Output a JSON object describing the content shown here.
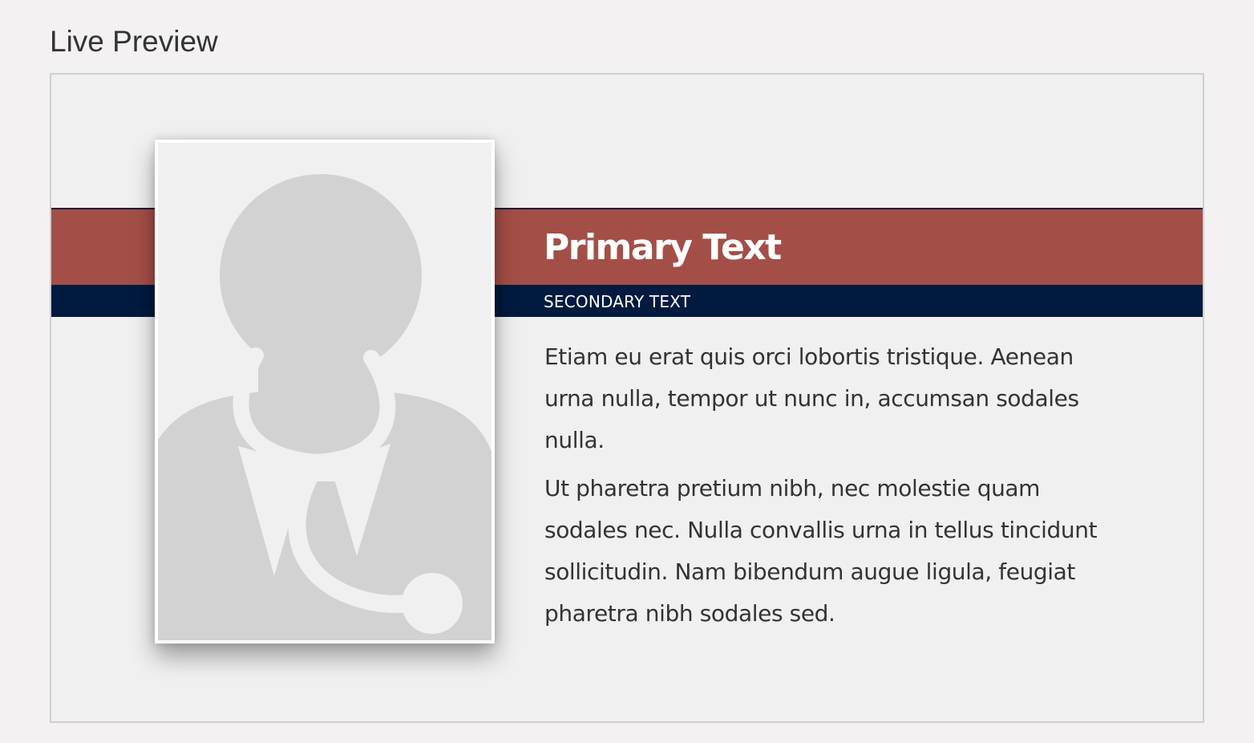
{
  "section": {
    "title": "Live Preview"
  },
  "preview": {
    "primary_text": "Primary Text",
    "secondary_text": "SECONDARY TEXT",
    "paragraphs": [
      "Etiam eu erat quis orci lobortis tristique. Aenean urna nulla, tempor ut nunc in, accumsan sodales nulla.",
      "Ut pharetra pretium nibh, nec molestie quam sodales nec. Nulla convallis urna in tellus tincidunt sollicitudin. Nam bibendum augue ligula, feugiat pharetra nibh sodales sed."
    ],
    "photo_icon": "doctor-placeholder-icon"
  },
  "colors": {
    "primary_band": "#a34f47",
    "secondary_band": "#001a40",
    "placeholder_fill": "#d2d2d2"
  }
}
